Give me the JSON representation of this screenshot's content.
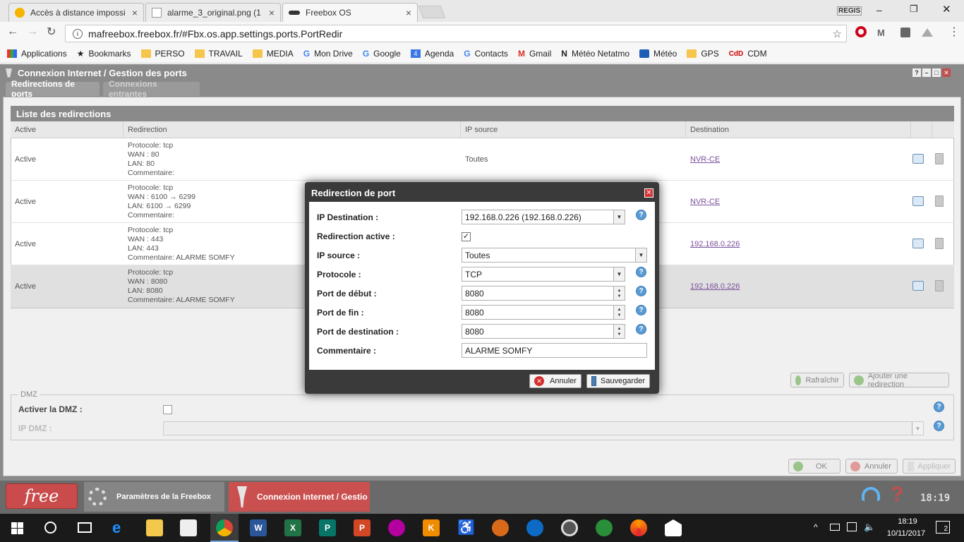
{
  "browser": {
    "tabs": [
      {
        "label": "Accès à distance impossi"
      },
      {
        "label": "alarme_3_original.png (1"
      },
      {
        "label": "Freebox OS"
      }
    ],
    "profile": "REGIS",
    "url": "mafreebox.freebox.fr/#Fbx.os.app.settings.ports.PortRedir",
    "bookmarks": [
      "Applications",
      "Bookmarks",
      "PERSO",
      "TRAVAIL",
      "MEDIA",
      "Mon Drive",
      "Google",
      "Agenda",
      "Contacts",
      "Gmail",
      "Météo Netatmo",
      "Météo",
      "GPS",
      "CDM"
    ]
  },
  "window": {
    "title": "Connexion Internet / Gestion des ports",
    "controls": [
      "?",
      "–",
      "□",
      "✕"
    ],
    "subtabs": [
      "Redirections de ports",
      "Connexions entrantes"
    ]
  },
  "list": {
    "title": "Liste des redirections",
    "columns": [
      "Active",
      "Redirection",
      "IP source",
      "Destination"
    ],
    "rows": [
      {
        "active": "Active",
        "l1": "Protocole: tcp",
        "l2": "WAN : 80",
        "l3": "LAN: 80",
        "l4": "Commentaire:",
        "ip": "Toutes",
        "dest": "NVR-CE"
      },
      {
        "active": "Active",
        "l1": "Protocole: tcp",
        "l2": "WAN : 6100 → 6299",
        "l3": "LAN: 6100 → 6299",
        "l4": "Commentaire:",
        "ip": "",
        "dest": "NVR-CE"
      },
      {
        "active": "Active",
        "l1": "Protocole: tcp",
        "l2": "WAN : 443",
        "l3": "LAN: 443",
        "l4": "Commentaire: ALARME SOMFY",
        "ip": "",
        "dest": "192.168.0.226"
      },
      {
        "active": "Active",
        "l1": "Protocole: tcp",
        "l2": "WAN : 8080",
        "l3": "LAN: 8080",
        "l4": "Commentaire: ALARME SOMFY",
        "ip": "",
        "dest": "192.168.0.226"
      }
    ],
    "refresh": "Rafraîchir",
    "add": "Ajouter une redirection"
  },
  "dmz": {
    "legend": "DMZ",
    "enable_label": "Activer la DMZ :",
    "ip_label": "IP DMZ :"
  },
  "footer": {
    "ok": "OK",
    "cancel": "Annuler",
    "apply": "Appliquer"
  },
  "dialog": {
    "title": "Redirection de port",
    "ip_dest_label": "IP Destination :",
    "ip_dest_value": "192.168.0.226 (192.168.0.226)",
    "active_label": "Redirection active :",
    "ip_source_label": "IP source :",
    "ip_source_value": "Toutes",
    "proto_label": "Protocole :",
    "proto_value": "TCP",
    "start_label": "Port de début :",
    "start_value": "8080",
    "end_label": "Port de fin :",
    "end_value": "8080",
    "destport_label": "Port de destination :",
    "destport_value": "8080",
    "comment_label": "Commentaire :",
    "comment_value": "ALARME SOMFY",
    "cancel": "Annuler",
    "save": "Sauvegarder"
  },
  "fbx_taskbar": {
    "logo": "free",
    "apps": [
      "Paramètres de la Freebox",
      "Connexion Internet / Gestio"
    ],
    "clock": "18:19"
  },
  "win_taskbar": {
    "time": "18:19",
    "date": "10/11/2017",
    "notif": "2"
  },
  "colors": {
    "accent": "#c0504d",
    "link": "#7a4f9b",
    "help": "#5a9bd5"
  }
}
